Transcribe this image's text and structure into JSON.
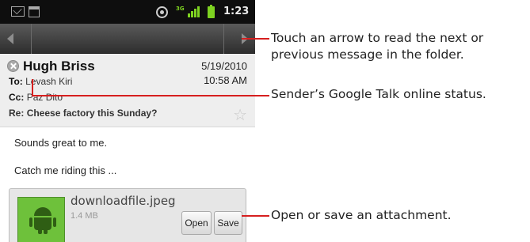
{
  "status_bar": {
    "icons": [
      "mail-icon",
      "calendar-icon",
      "gps-icon",
      "data-3g-icon",
      "signal-icon",
      "battery-icon"
    ],
    "data_indicator": "3G",
    "time": "1:23"
  },
  "nav_bar": {
    "prev_icon": "chevron-left-icon",
    "next_icon": "chevron-right-icon"
  },
  "message": {
    "sender": "Hugh Briss",
    "date": "5/19/2010",
    "time": "10:58 AM",
    "to_label": "To:",
    "to_value": "Levash Kiri",
    "cc_label": "Cc:",
    "cc_value": "Paz Dito",
    "subject_label": "Re:",
    "subject": "Cheese factory this Sunday?",
    "presence_icon": "presence-offline-icon",
    "star_icon": "star-icon",
    "body_lines": [
      "Sounds great to me.",
      "Catch me riding this ..."
    ]
  },
  "attachment": {
    "filename": "downloadfile.jpeg",
    "size": "1.4 MB",
    "open_label": "Open",
    "save_label": "Save",
    "thumbnail_icon": "android-icon"
  },
  "callouts": {
    "nav": [
      "Touch an arrow to read the next or",
      "previous message in the folder."
    ],
    "status": "Sender’s Google Talk online status.",
    "attachment": "Open or save an attachment."
  },
  "colors": {
    "callout_line": "#d61f1f",
    "status_green": "#7ed321",
    "header_bg": "#eeeeee"
  }
}
